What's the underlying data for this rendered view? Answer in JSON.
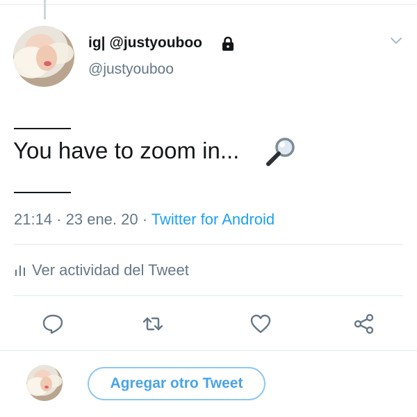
{
  "tweet": {
    "display_name": "ig| @justyouboo",
    "handle": "@justyouboo",
    "rule_top": "_____",
    "text": "You have to zoom in...",
    "rule_bottom": "_____",
    "time": "21:14",
    "date": "23 ene. 20",
    "source": "Twitter for Android",
    "separator": " · "
  },
  "activity": {
    "label": "Ver actividad del Tweet"
  },
  "actions": {
    "reply_icon": "reply-icon",
    "retweet_icon": "retweet-icon",
    "like_icon": "heart-icon",
    "share_icon": "share-icon"
  },
  "composer": {
    "button_label": "Agregar otro Tweet"
  },
  "colors": {
    "accent": "#1da1f2",
    "secondary_text": "#657786",
    "primary_text": "#14171a",
    "divider": "#e1e8ed"
  }
}
